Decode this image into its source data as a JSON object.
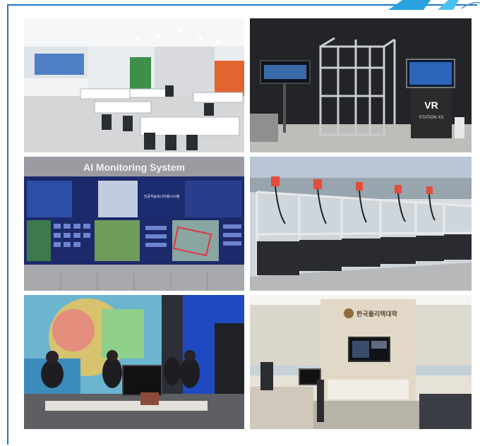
{
  "photos": [
    {
      "id": "lounge",
      "description": "Bright lounge with white tables and black chairs"
    },
    {
      "id": "vr-lab",
      "description": "VR lab with metal frame and VR station kiosk",
      "kiosk_label": "VR",
      "kiosk_sublabel": "STATION XS"
    },
    {
      "id": "monitoring",
      "description": "Video wall",
      "title": "AI Monitoring System"
    },
    {
      "id": "robot-cells",
      "description": "Row of aluminum enclosure robot cells"
    },
    {
      "id": "studio",
      "description": "Media studio with projected artwork and students"
    },
    {
      "id": "lobby",
      "description": "Reception lobby",
      "sign": "한국폴리텍대학"
    }
  ]
}
